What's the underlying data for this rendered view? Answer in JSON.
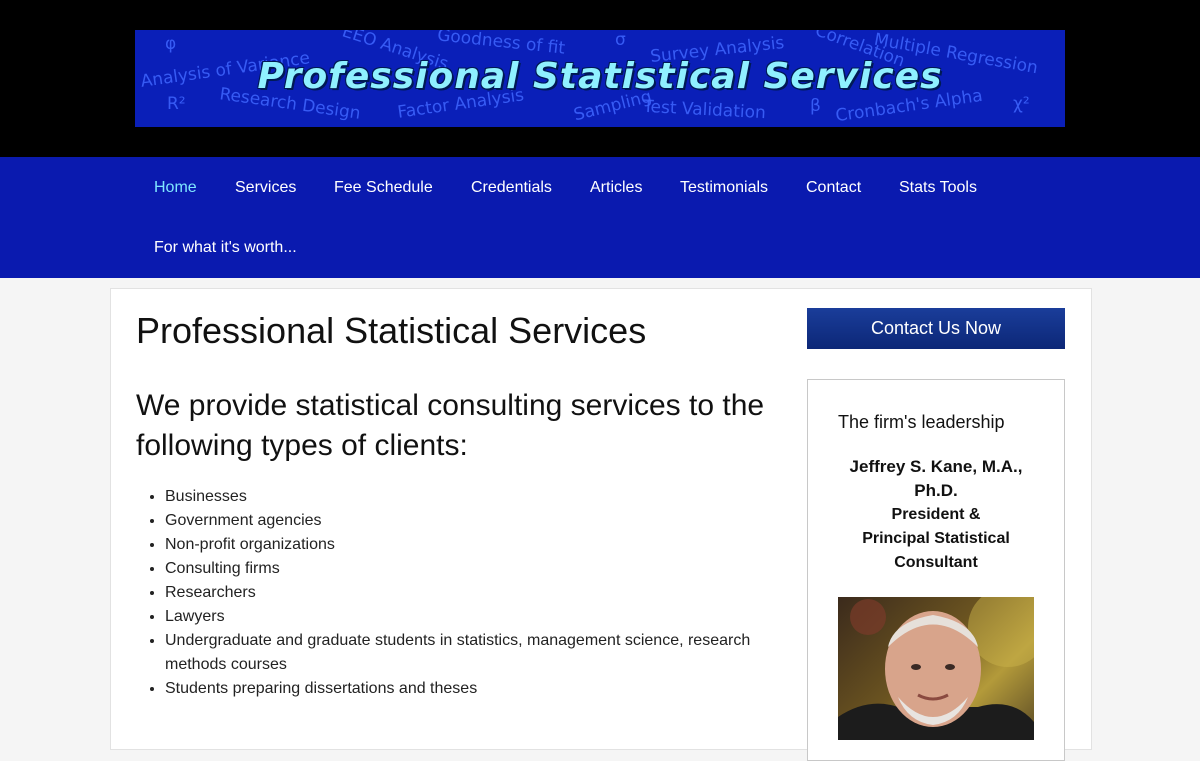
{
  "banner": {
    "title": "Professional Statistical Services",
    "watermark_terms": [
      "Analysis of Variance",
      "EEO Analysis",
      "Goodness of fit",
      "Survey Analysis",
      "Correlation",
      "Multiple Regression",
      "Research Design",
      "Factor Analysis",
      "Sampling",
      "Test Validation",
      "Cronbach's Alpha",
      "φ",
      "σ",
      "β",
      "R²",
      "χ²"
    ]
  },
  "nav": {
    "items": [
      "Home",
      "Services",
      "Fee Schedule",
      "Credentials",
      "Articles",
      "Testimonials",
      "Contact",
      "Stats Tools",
      "For what it's worth..."
    ],
    "active": "Home"
  },
  "main": {
    "title": "Professional Statistical Services",
    "intro": "We provide statistical consulting services to the following types of clients:",
    "clients": [
      "Businesses",
      "Government agencies",
      "Non-profit organizations",
      "Consulting firms",
      "Researchers",
      "Lawyers",
      "Undergraduate and graduate students in statistics, management science, research methods courses",
      "Students preparing dissertations and theses"
    ]
  },
  "sidebar": {
    "cta_label": "Contact Us Now",
    "heading": "The firm's leadership",
    "person_name": "Jeffrey S. Kane, M.A., Ph.D.",
    "person_role_1": "President &",
    "person_role_2": "Principal Statistical Consultant"
  },
  "colors": {
    "header_bg": "#000000",
    "banner_bg": "#0a1fb8",
    "nav_bg": "#0a1aaf",
    "nav_active": "#7fe6ff",
    "cta_bg": "#12307f"
  }
}
